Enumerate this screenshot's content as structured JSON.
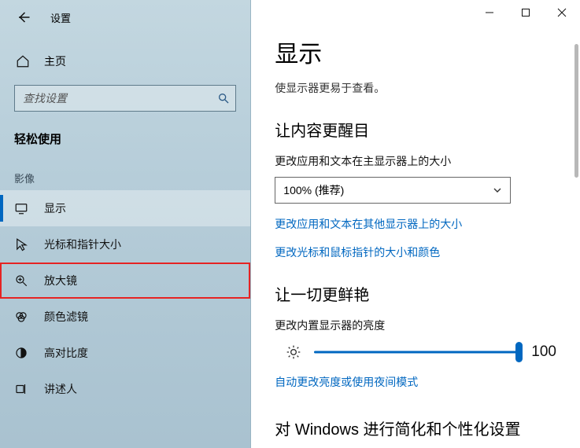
{
  "titlebar": {
    "title": "设置"
  },
  "home": {
    "label": "主页"
  },
  "search": {
    "placeholder": "查找设置"
  },
  "ease_section": "轻松使用",
  "group_video": "影像",
  "sidebar": {
    "items": [
      {
        "label": "显示"
      },
      {
        "label": "光标和指针大小"
      },
      {
        "label": "放大镜"
      },
      {
        "label": "颜色滤镜"
      },
      {
        "label": "高对比度"
      },
      {
        "label": "讲述人"
      }
    ]
  },
  "main": {
    "h1": "显示",
    "subtitle": "使显示器更易于查看。",
    "section1": "让内容更醒目",
    "scale_label": "更改应用和文本在主显示器上的大小",
    "scale_value": "100% (推荐)",
    "link1": "更改应用和文本在其他显示器上的大小",
    "link2": "更改光标和鼠标指针的大小和颜色",
    "section2": "让一切更鲜艳",
    "brightness_label": "更改内置显示器的亮度",
    "brightness_value": "100",
    "link3": "自动更改亮度或使用夜间模式",
    "section3": "对 Windows 进行简化和个性化设置"
  }
}
